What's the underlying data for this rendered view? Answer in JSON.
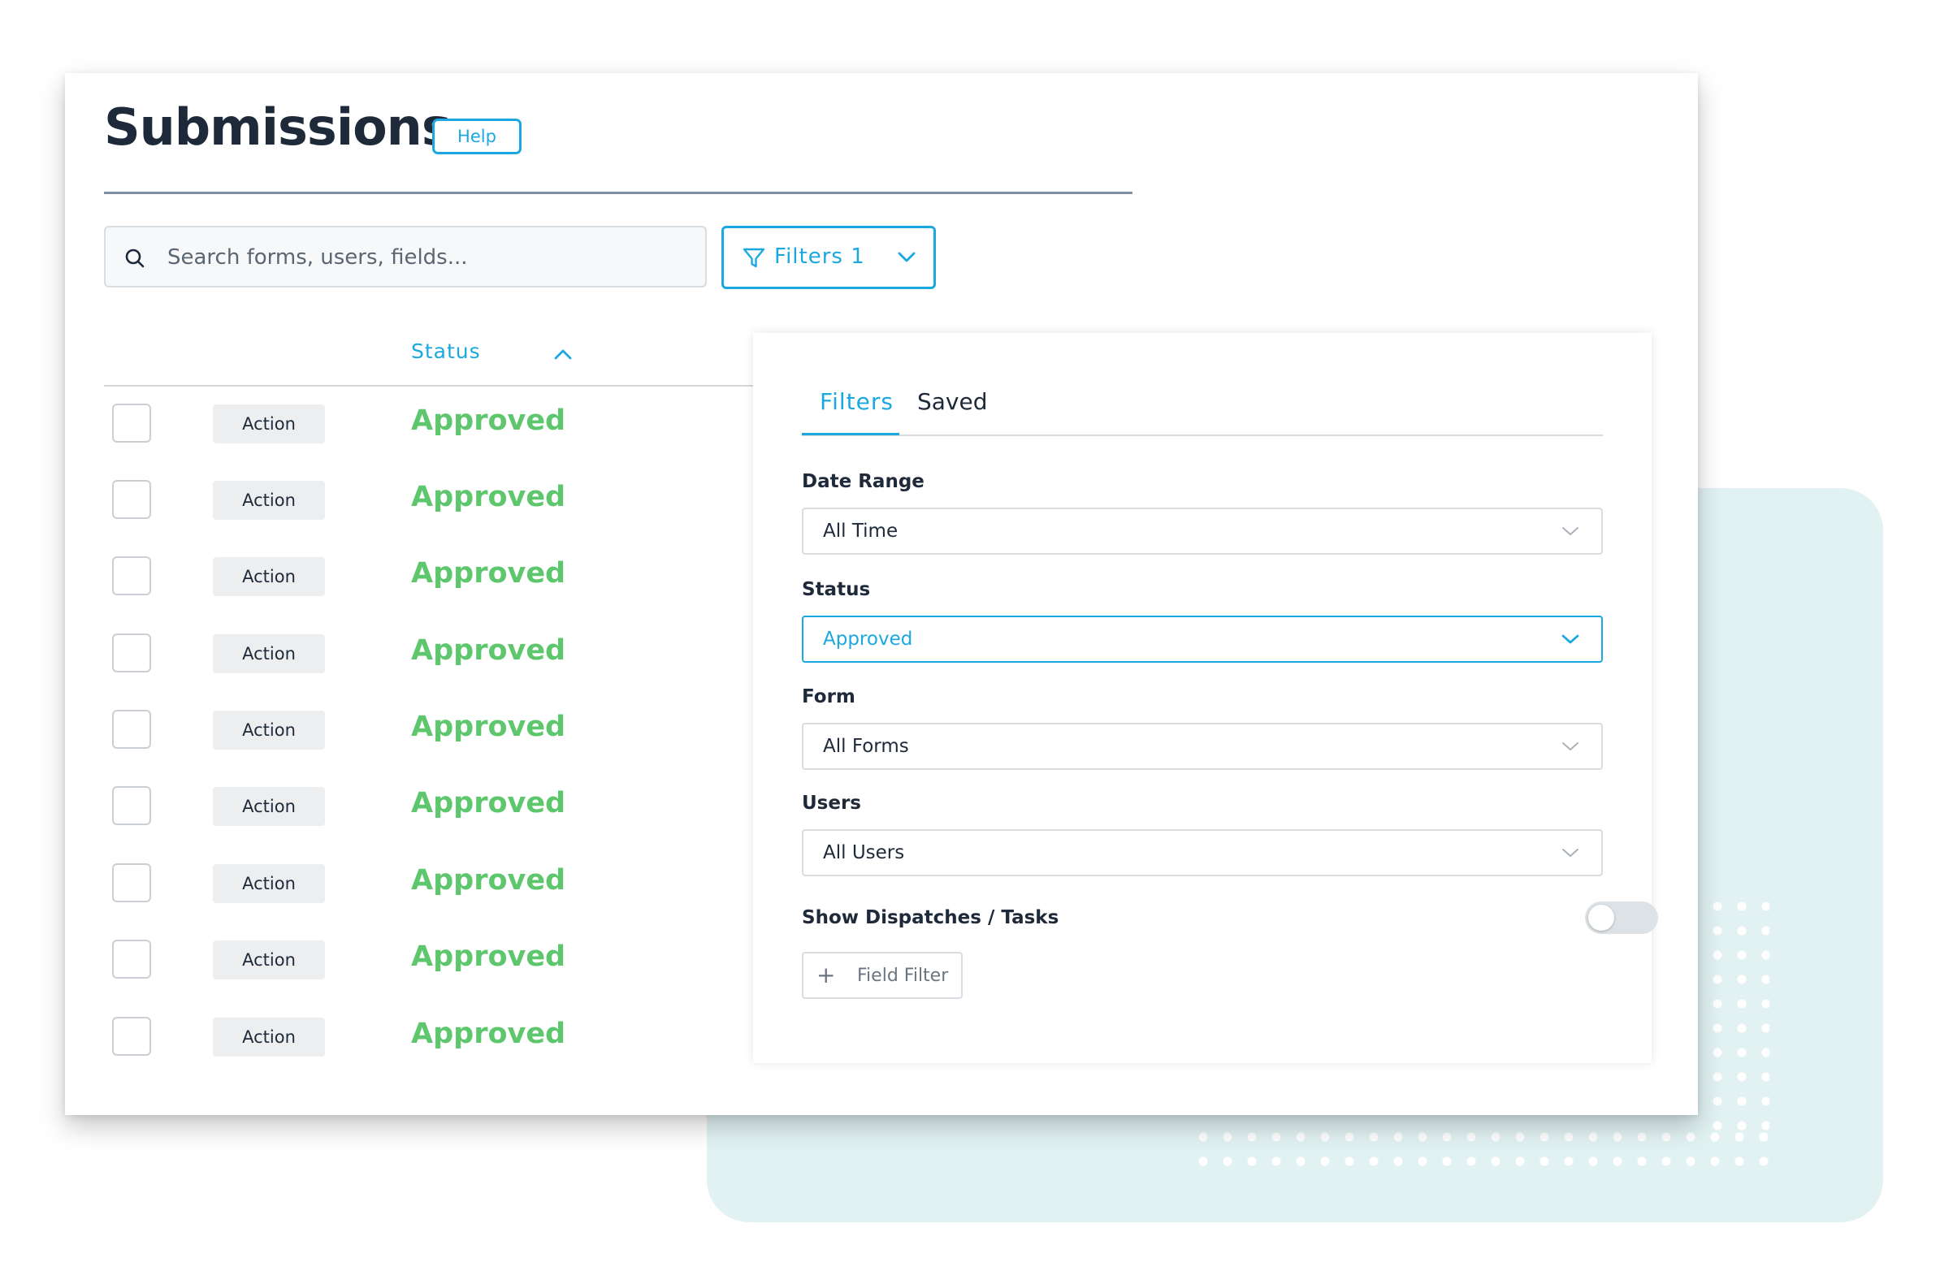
{
  "page": {
    "title": "Submissions",
    "help_label": "Help"
  },
  "search": {
    "placeholder": "Search forms, users, fields..."
  },
  "filters_button": {
    "label": "Filters 1"
  },
  "table": {
    "status_header": "Status",
    "rows": [
      {
        "action": "Action",
        "status": "Approved"
      },
      {
        "action": "Action",
        "status": "Approved"
      },
      {
        "action": "Action",
        "status": "Approved"
      },
      {
        "action": "Action",
        "status": "Approved"
      },
      {
        "action": "Action",
        "status": "Approved"
      },
      {
        "action": "Action",
        "status": "Approved"
      },
      {
        "action": "Action",
        "status": "Approved"
      },
      {
        "action": "Action",
        "status": "Approved"
      },
      {
        "action": "Action",
        "status": "Approved"
      }
    ]
  },
  "filter_panel": {
    "tabs": [
      {
        "label": "Filters",
        "active": true
      },
      {
        "label": "Saved",
        "active": false
      }
    ],
    "date_range": {
      "label": "Date Range",
      "value": "All Time"
    },
    "status": {
      "label": "Status",
      "value": "Approved"
    },
    "form": {
      "label": "Form",
      "value": "All Forms"
    },
    "users": {
      "label": "Users",
      "value": "All Users"
    },
    "show_dispatches": {
      "label": "Show Dispatches / Tasks",
      "enabled": false
    },
    "field_filter": {
      "label": "Field Filter",
      "icon": "plus-icon"
    }
  },
  "colors": {
    "accent": "#1ba8e0",
    "approved": "#5ec76d",
    "title": "#1e2a3a",
    "background_block": "#e2f2f3"
  }
}
